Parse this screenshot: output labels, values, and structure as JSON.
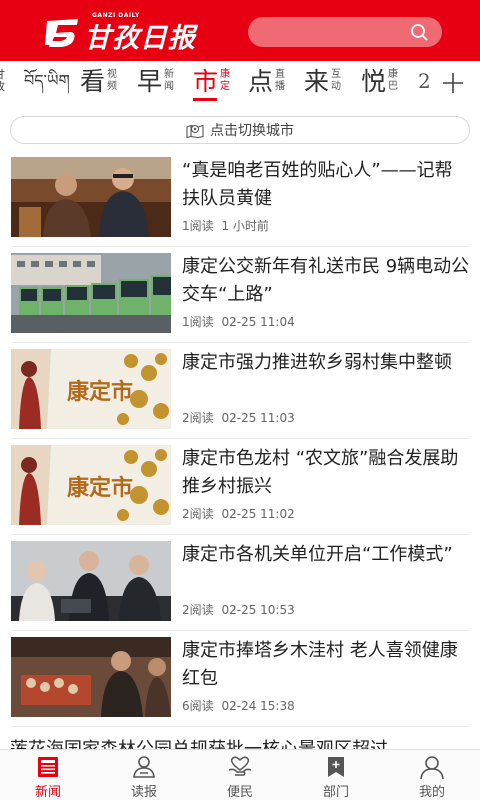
{
  "header": {
    "logo_text": "甘孜日报",
    "logo_en": "GANZI DAILY"
  },
  "channels": {
    "items": [
      {
        "big": "",
        "small": [
          "甘",
          "孜"
        ]
      },
      {
        "big": "བོད་ཡིག",
        "small": []
      },
      {
        "big": "看",
        "small": [
          "视",
          "频"
        ]
      },
      {
        "big": "早",
        "small": [
          "新",
          "闻"
        ]
      },
      {
        "big": "市",
        "small": [
          "康",
          "定"
        ]
      },
      {
        "big": "点",
        "small": [
          "直",
          "播"
        ]
      },
      {
        "big": "来",
        "small": [
          "互",
          "动"
        ]
      },
      {
        "big": "悦",
        "small": [
          "康",
          "巴"
        ]
      },
      {
        "big": "2",
        "small": []
      }
    ],
    "active_index": 4
  },
  "city_switch": {
    "label": "点击切换城市"
  },
  "news": [
    {
      "title": "“真是咱老百姓的贴心人”——记帮扶队员黄健",
      "reads": "1阅读",
      "time": "1 小时前"
    },
    {
      "title": "康定公交新年有礼送市民 9辆电动公交车“上路”",
      "reads": "1阅读",
      "time": "02-25 11:04"
    },
    {
      "title": "康定市强力推进软乡弱村集中整顿",
      "reads": "2阅读",
      "time": "02-25 11:03"
    },
    {
      "title": "康定市色龙村 “农文旅”融合发展助推乡村振兴",
      "reads": "2阅读",
      "time": "02-25 11:02"
    },
    {
      "title": "康定市各机关单位开启“工作模式”",
      "reads": "2阅读",
      "time": "02-25 10:53"
    },
    {
      "title": "康定市捧塔乡木洼村 老人喜领健康红包",
      "reads": "6阅读",
      "time": "02-24 15:38"
    }
  ],
  "thumb_texts": {
    "kangding": "康定市"
  },
  "partial_title": "莲花海国家森林公园总规获批一核心景观区超过",
  "tabbar": {
    "items": [
      {
        "label": "新闻",
        "icon": "newspaper-icon"
      },
      {
        "label": "读报",
        "icon": "reader-icon"
      },
      {
        "label": "便民",
        "icon": "service-icon"
      },
      {
        "label": "部门",
        "icon": "department-icon"
      },
      {
        "label": "我的",
        "icon": "user-icon"
      }
    ],
    "active_index": 0
  },
  "colors": {
    "brand_red": "#e60012",
    "search_bg": "#ef6a73"
  }
}
